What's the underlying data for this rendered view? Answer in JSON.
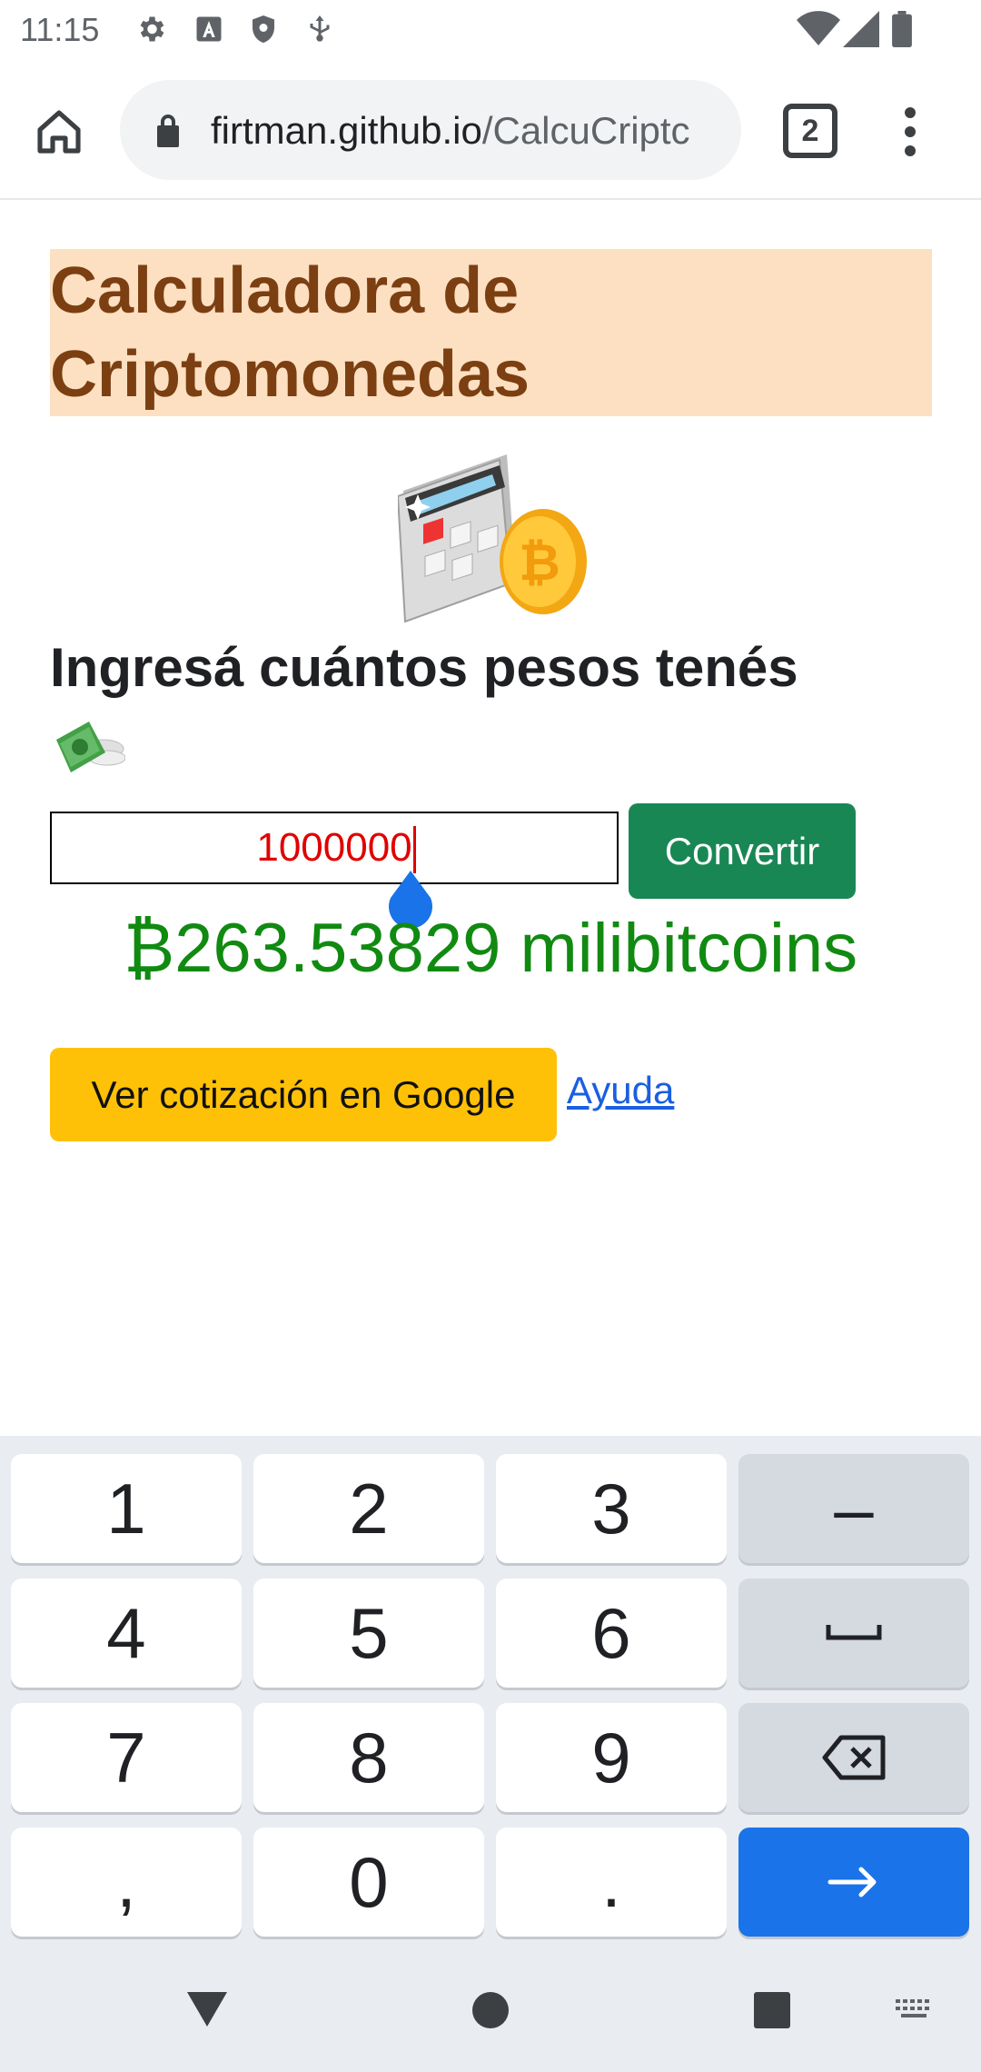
{
  "status_bar": {
    "time": "11:15",
    "left_icons": [
      "settings-icon",
      "keyboard-a-icon",
      "shield-icon",
      "usb-debug-icon"
    ],
    "right_icons": [
      "wifi-icon",
      "signal-icon",
      "battery-icon"
    ]
  },
  "browser": {
    "url_host": "firtman.github.io",
    "url_path": "/CalcuCriptc",
    "tab_count": "2",
    "icons": [
      "home-icon",
      "lock-icon",
      "tabs-icon",
      "more-vert-icon"
    ]
  },
  "page": {
    "title_line1": "Calculadora de",
    "title_line2": "Criptomonedas",
    "prompt": "Ingresá cuántos pesos tenés",
    "input_value": "1000000",
    "convert_label": "Convertir",
    "result": "₿263.53829 milibitcoins",
    "google_label": "Ver cotización en Google",
    "help_label": "Ayuda",
    "colors": {
      "title_bg": "#fde0c2",
      "title_text": "#7b3f12",
      "convert_bg": "#198754",
      "result_text": "#118a11",
      "google_bg": "#ffc107",
      "input_text": "#e00000",
      "link": "#1a5fe0"
    }
  },
  "keyboard": {
    "rows": [
      [
        {
          "label": "1"
        },
        {
          "label": "2"
        },
        {
          "label": "3"
        },
        {
          "label": "–",
          "icon": "minus-key"
        }
      ],
      [
        {
          "label": "4"
        },
        {
          "label": "5"
        },
        {
          "label": "6"
        },
        {
          "label": "",
          "icon": "space-icon"
        }
      ],
      [
        {
          "label": "7"
        },
        {
          "label": "8"
        },
        {
          "label": "9"
        },
        {
          "label": "",
          "icon": "backspace-icon"
        }
      ],
      [
        {
          "label": ","
        },
        {
          "label": "0"
        },
        {
          "label": "."
        },
        {
          "label": "",
          "icon": "enter-arrow-icon"
        }
      ]
    ]
  },
  "nav_bar": {
    "icons": [
      "back-icon",
      "home-circle-icon",
      "recents-icon",
      "keyboard-switch-icon"
    ]
  }
}
